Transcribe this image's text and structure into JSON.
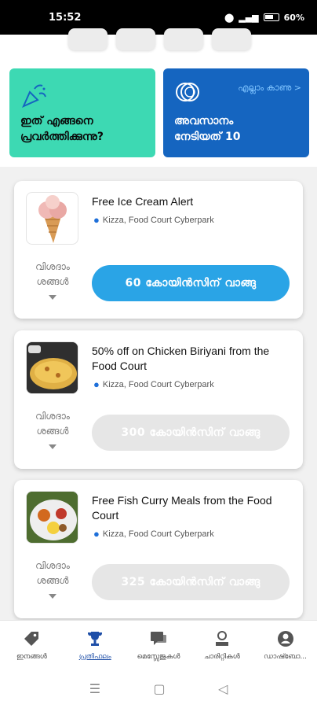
{
  "status_bar": {
    "time": "15:52",
    "battery": "60%"
  },
  "tiles": {
    "how_it_works": "ഇത് എങ്ങനെ പ്രവർത്തിക്കുന്നു?",
    "last_earned": "അവസാനം നേടിയത് 10",
    "see_all": "എല്ലാം കാണു >"
  },
  "offers": [
    {
      "title": "Free Ice Cream Alert",
      "location": "Kizza, Food Court Cyberpark",
      "details_label": "വിശദാം ശങ്ങൾ",
      "buy_label": "60 കോയിൻസിന് വാങ്ങു",
      "state": "active"
    },
    {
      "title": "50% off on Chicken Biriyani from the Food Court",
      "location": "Kizza, Food Court Cyberpark",
      "details_label": "വിശദാം ശങ്ങൾ",
      "buy_label": "300 കോയിൻസിന് വാങ്ങു",
      "state": "disabled"
    },
    {
      "title": "Free Fish Curry Meals from the Food Court",
      "location": "Kizza, Food Court Cyberpark",
      "details_label": "വിശദാം ശങ്ങൾ",
      "buy_label": "325 കോയിൻസിന് വാങ്ങു",
      "state": "disabled"
    }
  ],
  "bottom_nav": [
    {
      "label": "ഇനങ്ങൾ",
      "icon": "tag-icon",
      "active": false
    },
    {
      "label": "പ്രതിഫലം",
      "icon": "trophy-icon",
      "active": true
    },
    {
      "label": "മെസ്സേജുകൾ",
      "icon": "messages-icon",
      "active": false
    },
    {
      "label": "ചാരിറ്റികൾ",
      "icon": "charity-icon",
      "active": false
    },
    {
      "label": "ഡാഷ്ബോ...",
      "icon": "account-icon",
      "active": false
    }
  ],
  "colors": {
    "teal": "#3dd9b3",
    "blue": "#1565c0",
    "button_blue": "#2aa4e6",
    "nav_active": "#1f4fa8"
  }
}
